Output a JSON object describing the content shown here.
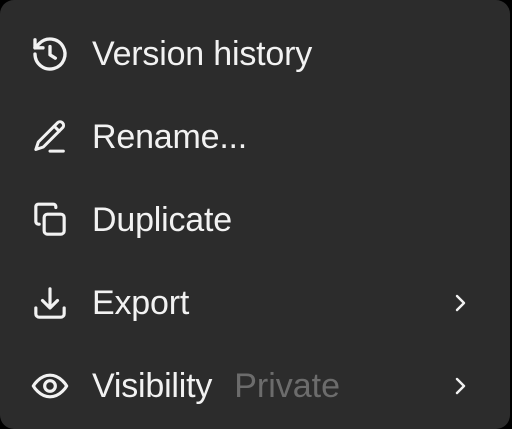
{
  "menu": {
    "items": [
      {
        "label": "Version history",
        "icon": "history-icon"
      },
      {
        "label": "Rename...",
        "icon": "pencil-icon"
      },
      {
        "label": "Duplicate",
        "icon": "duplicate-icon"
      },
      {
        "label": "Export",
        "icon": "download-icon",
        "has_submenu": true
      },
      {
        "label": "Visibility",
        "sub_label": "Private",
        "icon": "eye-icon",
        "has_submenu": true
      }
    ]
  },
  "colors": {
    "background": "#2c2c2c",
    "text": "#f2f2f2",
    "muted_text": "#6c6c6c"
  }
}
